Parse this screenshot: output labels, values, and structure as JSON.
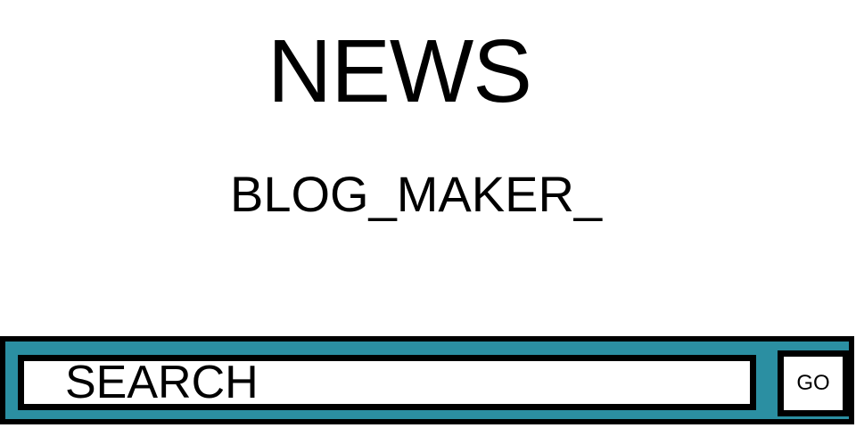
{
  "header": {
    "title": "NEWS",
    "subtitle": "BLOG_MAKER_"
  },
  "search": {
    "value": "",
    "placeholder": "SEARCH",
    "button_label": "GO"
  },
  "colors": {
    "search_bar_background": "#2b8fa2",
    "border": "#000000",
    "background": "#ffffff"
  }
}
